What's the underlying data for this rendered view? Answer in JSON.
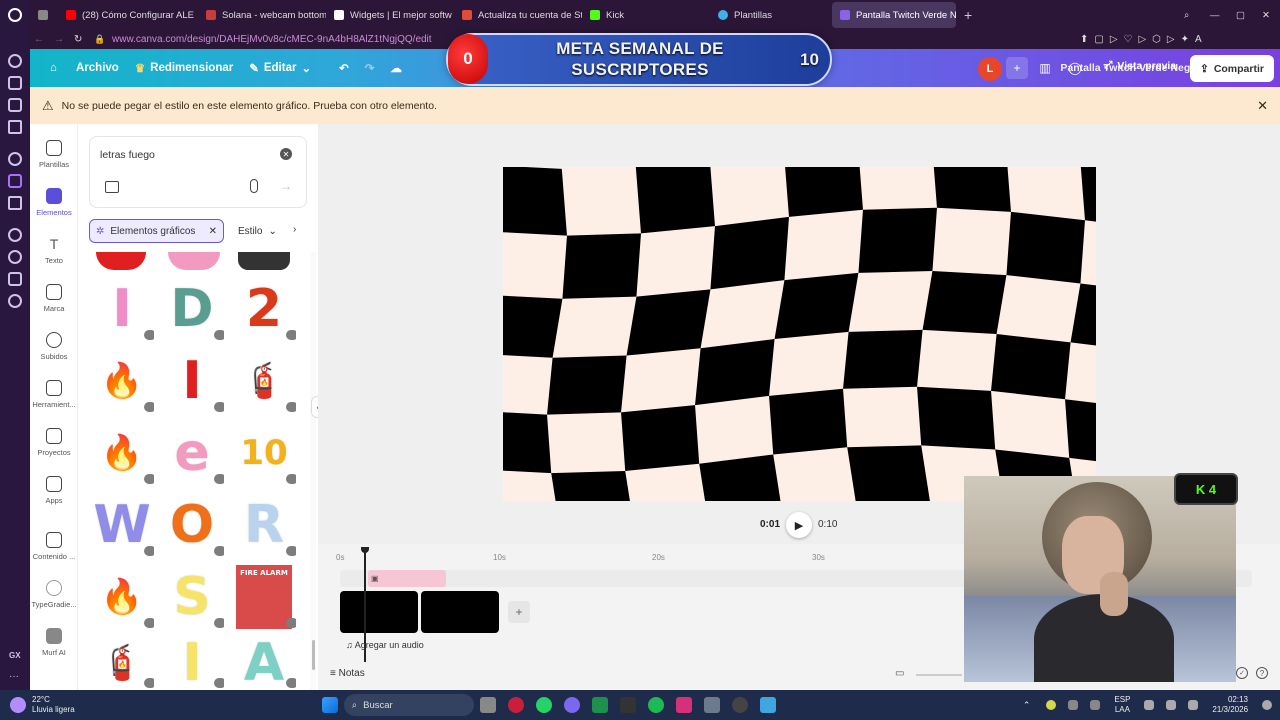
{
  "browser": {
    "tabs": [
      {
        "label": "(28) Cómo Configurar ALE",
        "color": "#ff0000"
      },
      {
        "label": "Solana - webcam bottom",
        "color": "#c83c3c"
      },
      {
        "label": "Widgets | El mejor softw",
        "color": "#ffffff"
      },
      {
        "label": "Actualiza tu cuenta de St",
        "color": "#e14b3a"
      },
      {
        "label": "Kick",
        "color": "#53fc18"
      },
      {
        "label": "Plantillas",
        "color": "#3fb0e8"
      },
      {
        "label": "Pantalla Twitch Verde Neg",
        "color": "#8a63e8"
      }
    ],
    "url": "www.canva.com/design/DAHEjMv0v8c/cMEC-9nA4bH8AlZ1tNgjQQ/edit"
  },
  "header": {
    "archivo": "Archivo",
    "redimensionar": "Redimensionar",
    "editar": "Editar",
    "doc_title": "Pantalla Twitch Verde Negro Comenzamos",
    "avatar_letter": "L",
    "vista_previa": "Vista previa",
    "compartir": "Compartir"
  },
  "overlay": {
    "count": "0",
    "title": "META SEMANAL DE SUSCRIPTORES",
    "goal": "10"
  },
  "warning": {
    "text": "No se puede pegar el estilo en este elemento gráfico. Prueba con otro elemento."
  },
  "rail": [
    {
      "label": "Plantillas"
    },
    {
      "label": "Elementos"
    },
    {
      "label": "Texto"
    },
    {
      "label": "Marca"
    },
    {
      "label": "Subidos"
    },
    {
      "label": "Herramient..."
    },
    {
      "label": "Proyectos"
    },
    {
      "label": "Apps"
    },
    {
      "label": "Contenido ..."
    },
    {
      "label": "TypeGradie..."
    },
    {
      "label": "Murf AI"
    }
  ],
  "panel": {
    "search_value": "letras fuego",
    "filter_chip": "Elementos gráficos",
    "style_dropdown": "Estilo",
    "tiles": [
      {
        "glyph": "I",
        "color": "#f08cc8"
      },
      {
        "glyph": "D",
        "color": "#5a9e92"
      },
      {
        "glyph": "2",
        "color": "#d93a1a"
      },
      {
        "glyph": "🔥",
        "color": "#e02020"
      },
      {
        "glyph": "I",
        "color": "#e02020"
      },
      {
        "glyph": "🧯",
        "color": "#c62828"
      },
      {
        "glyph": "🔥",
        "color": "#f08a1a"
      },
      {
        "glyph": "e",
        "color": "#f29ac0"
      },
      {
        "glyph": "10",
        "color": "#f2b21a"
      },
      {
        "glyph": "W",
        "color": "#8f8de8"
      },
      {
        "glyph": "O",
        "color": "#f0701a"
      },
      {
        "glyph": "R",
        "color": "#b9d3ee"
      },
      {
        "glyph": "🔥",
        "color": "#f05a1a"
      },
      {
        "glyph": "S",
        "color": "#f6e36a"
      },
      {
        "glyph": "FIRE ALARM",
        "color": "#d94a4a"
      },
      {
        "glyph": "🧯",
        "color": "#c62828"
      },
      {
        "glyph": "I",
        "color": "#f6e36a"
      },
      {
        "glyph": "A",
        "color": "#7ed0c4"
      }
    ]
  },
  "playback": {
    "current": "0:01",
    "total": "0:10"
  },
  "timeline": {
    "ticks": [
      "0s",
      "10s",
      "20s",
      "30s"
    ],
    "audio_label": "Agregar un audio",
    "notes_label": "Notas"
  },
  "overlay_widget": {
    "badge": "K 4"
  },
  "taskbar": {
    "temp": "22°C",
    "weather": "Lluvia ligera",
    "search_placeholder": "Buscar",
    "lang1": "ESP",
    "lang2": "LAA",
    "time": "02:13",
    "date": "21/3/2026"
  }
}
